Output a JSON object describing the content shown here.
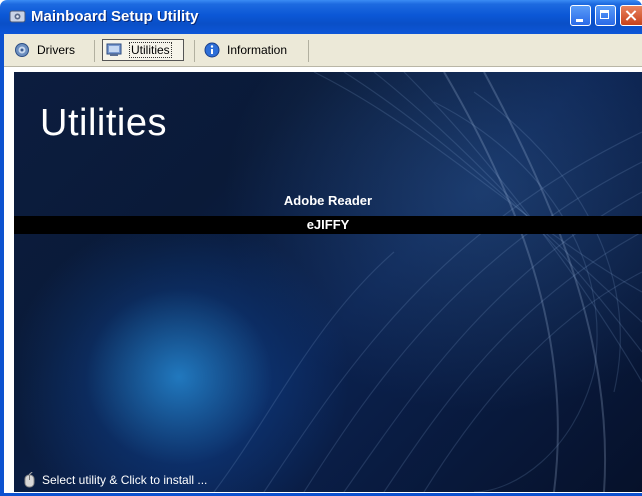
{
  "window": {
    "title": "Mainboard Setup Utility"
  },
  "tabs": [
    {
      "label": "Drivers",
      "icon": "gear-icon"
    },
    {
      "label": "Utilities",
      "icon": "utilities-icon",
      "active": true
    },
    {
      "label": "Information",
      "icon": "info-icon"
    }
  ],
  "main": {
    "heading": "Utilities",
    "items": [
      {
        "label": "Adobe Reader"
      },
      {
        "label": "eJIFFY",
        "highlighted": true
      }
    ],
    "status": "Select utility & Click to install ..."
  },
  "colors": {
    "titlebar": "#0b57d6",
    "panel_background": "#0a1a38",
    "highlight_bar": "#000000",
    "text": "#ffffff"
  }
}
